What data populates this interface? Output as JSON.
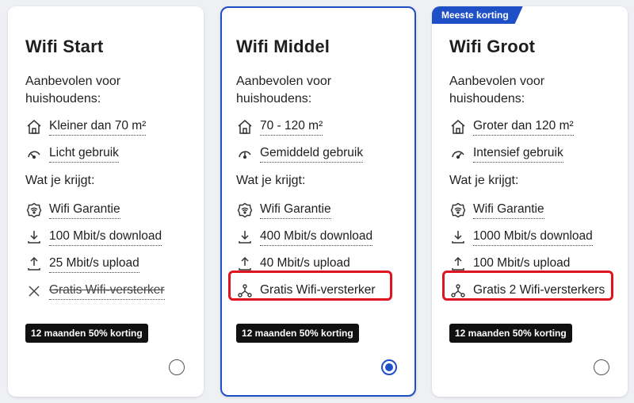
{
  "plans": [
    {
      "title": "Wifi Start",
      "recommended_label": "Aanbevolen voor huishoudens:",
      "recommended": [
        {
          "icon": "house-icon",
          "text": "Kleiner dan 70 m²"
        },
        {
          "icon": "gauge-low-icon",
          "text": "Licht gebruik"
        }
      ],
      "includes_label": "Wat je krijgt:",
      "features": [
        {
          "icon": "wifi-shield-icon",
          "text": "Wifi Garantie",
          "strike": false
        },
        {
          "icon": "download-icon",
          "text": "100 Mbit/s download",
          "strike": false
        },
        {
          "icon": "upload-icon",
          "text": "25 Mbit/s upload",
          "strike": false
        },
        {
          "icon": "cross-icon",
          "text": "Gratis Wifi-versterker",
          "strike": true
        }
      ],
      "discount_badge": "12 maanden 50% korting",
      "selected": false
    },
    {
      "title": "Wifi Middel",
      "recommended_label": "Aanbevolen voor huishoudens:",
      "recommended": [
        {
          "icon": "house-icon",
          "text": "70 - 120 m²"
        },
        {
          "icon": "gauge-mid-icon",
          "text": "Gemiddeld gebruik"
        }
      ],
      "includes_label": "Wat je krijgt:",
      "features": [
        {
          "icon": "wifi-shield-icon",
          "text": "Wifi Garantie",
          "strike": false
        },
        {
          "icon": "download-icon",
          "text": "400 Mbit/s download",
          "strike": false
        },
        {
          "icon": "upload-icon",
          "text": "40 Mbit/s upload",
          "strike": false
        },
        {
          "icon": "mesh-icon",
          "text": "Gratis Wifi-versterker",
          "strike": false
        }
      ],
      "discount_badge": "12 maanden 50% korting",
      "selected": true
    },
    {
      "title": "Wifi Groot",
      "top_badge": "Meeste korting",
      "recommended_label": "Aanbevolen voor huishoudens:",
      "recommended": [
        {
          "icon": "house-icon",
          "text": "Groter dan 120 m²"
        },
        {
          "icon": "gauge-high-icon",
          "text": "Intensief gebruik"
        }
      ],
      "includes_label": "Wat je krijgt:",
      "features": [
        {
          "icon": "wifi-shield-icon",
          "text": "Wifi Garantie",
          "strike": false
        },
        {
          "icon": "download-icon",
          "text": "1000 Mbit/s download",
          "strike": false
        },
        {
          "icon": "upload-icon",
          "text": "100 Mbit/s upload",
          "strike": false
        },
        {
          "icon": "mesh-icon",
          "text": "Gratis 2 Wifi-versterkers",
          "strike": false
        }
      ],
      "discount_badge": "12 maanden 50% korting",
      "selected": false
    }
  ],
  "colors": {
    "accent": "#1f4fc7",
    "highlight": "#e0141e",
    "badge_dark": "#111111"
  }
}
